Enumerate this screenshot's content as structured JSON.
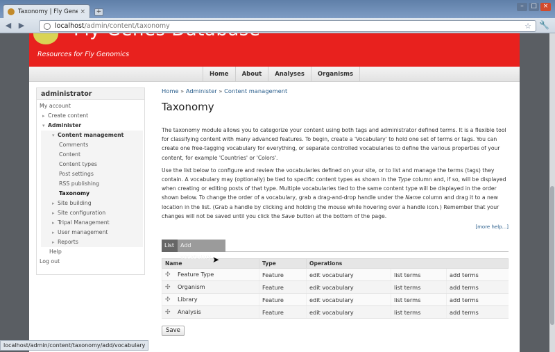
{
  "browser": {
    "tab_title": "Taxonomy | Fly Genes...",
    "tab_close": "×",
    "new_tab": "+",
    "url_host": "localhost",
    "url_path": "/admin/content/taxonomy",
    "status_url": "localhost/admin/content/taxonomy/add/vocabulary"
  },
  "site": {
    "name": "Fly Genes Database",
    "slogan": "Resources for Fly Genomics",
    "primary_links": [
      "Home",
      "About",
      "Analyses",
      "Organisms"
    ]
  },
  "sidebar": {
    "title": "administrator",
    "items": {
      "my_account": "My account",
      "create_content": "Create content",
      "administer": "Administer",
      "content_management": "Content management",
      "comments": "Comments",
      "content": "Content",
      "content_types": "Content types",
      "post_settings": "Post settings",
      "rss_publishing": "RSS publishing",
      "taxonomy": "Taxonomy",
      "site_building": "Site building",
      "site_configuration": "Site configuration",
      "tripal_management": "Tripal Management",
      "user_management": "User management",
      "reports": "Reports",
      "help": "Help",
      "log_out": "Log out"
    }
  },
  "main": {
    "breadcrumb": [
      "Home",
      "Administer",
      "Content management"
    ],
    "breadcrumb_sep": "»",
    "title": "Taxonomy",
    "para1": "The taxonomy module allows you to categorize your content using both tags and administrator defined terms. It is a flexible tool for classifying content with many advanced features. To begin, create a 'Vocabulary' to hold one set of terms or tags. You can create one free-tagging vocabulary for everything, or separate controlled vocabularies to define the various properties of your content, for example 'Countries' or 'Colors'.",
    "para2_a": "Use the list below to configure and review the vocabularies defined on your site, or to list and manage the terms (tags) they contain. A vocabulary may (optionally) be tied to specific content types as shown in the ",
    "para2_em1": "Type",
    "para2_b": " column and, if so, will be displayed when creating or editing posts of that type. Multiple vocabularies tied to the same content type will be displayed in the order shown below. To change the order of a vocabulary, grab a drag-and-drop handle under the ",
    "para2_em2": "Name",
    "para2_c": " column and drag it to a new location in the list. (Grab a handle by clicking and holding the mouse while hovering over a handle icon.) Remember that your changes will not be saved until you click the ",
    "para2_em3": "Save",
    "para2_d": " button at the bottom of the page.",
    "more_help": "[more help...]",
    "tabs": {
      "list": "List",
      "add": "Add vocabulary"
    },
    "table": {
      "headers": {
        "name": "Name",
        "type": "Type",
        "operations": "Operations"
      },
      "rows": [
        {
          "name": "Feature Type",
          "type": "Feature",
          "edit": "edit vocabulary",
          "list": "list terms",
          "add": "add terms"
        },
        {
          "name": "Organism",
          "type": "Feature",
          "edit": "edit vocabulary",
          "list": "list terms",
          "add": "add terms"
        },
        {
          "name": "Library",
          "type": "Feature",
          "edit": "edit vocabulary",
          "list": "list terms",
          "add": "add terms"
        },
        {
          "name": "Analysis",
          "type": "Feature",
          "edit": "edit vocabulary",
          "list": "list terms",
          "add": "add terms"
        }
      ]
    },
    "save": "Save"
  },
  "icons": {
    "drag_handle": "✣",
    "back": "◀",
    "forward": "▶",
    "reload": "↻",
    "star": "☆",
    "wrench": "🔧"
  }
}
